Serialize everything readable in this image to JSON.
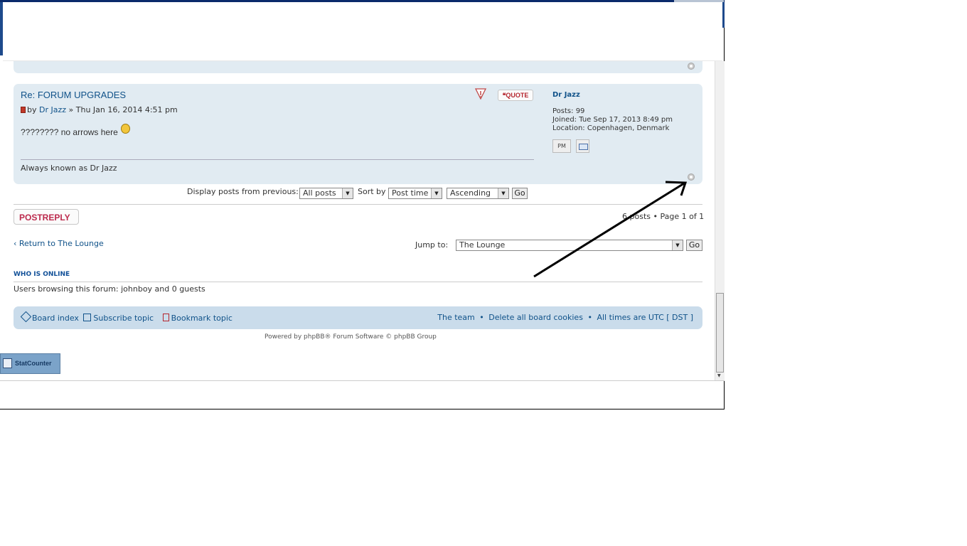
{
  "post": {
    "title": "Re: FORUM UPGRADES",
    "meta_prefix": "by ",
    "author": "Dr Jazz",
    "meta_suffix": " » Thu Jan 16, 2014 4:51 pm",
    "body": "???????? no arrows here",
    "signature": "Always known as Dr Jazz",
    "quote_label": "❝QUOTE",
    "profile": {
      "name": "Dr Jazz",
      "posts_label": "Posts: ",
      "posts_value": "99",
      "joined_label": "Joined: ",
      "joined_value": "Tue Sep 17, 2013 8:49 pm",
      "location_label": "Location: ",
      "location_value": "Copenhagen, Denmark",
      "pm_label": "PM"
    }
  },
  "display": {
    "label": "Display posts from previous:",
    "days_value": "All posts",
    "sort_label": "Sort by",
    "sort_value": "Post time",
    "dir_value": "Ascending",
    "go_label": "Go"
  },
  "actions": {
    "postreply_label": "POSTREPLY",
    "pagination": "6 posts • Page 1 of 1"
  },
  "jump": {
    "return_link": "‹ Return to The Lounge",
    "label": "Jump to:",
    "value": "The Lounge",
    "go_label": "Go"
  },
  "online": {
    "title": "WHO IS ONLINE",
    "text": "Users browsing this forum: johnboy and 0 guests"
  },
  "navbar": {
    "board_index": "Board index",
    "subscribe": "Subscribe topic",
    "bookmark": "Bookmark topic",
    "team": "The team",
    "delete_cookies": "Delete all board cookies",
    "times": "All times are UTC [ DST ]"
  },
  "footer": {
    "powered": "Powered by phpBB® Forum Software © phpBB Group",
    "statcounter": "StatCounter"
  },
  "colors": {
    "panel_bg": "#e1ebf2",
    "navbar_bg": "#cadceb",
    "link": "#105289",
    "accent_red": "#bc2a4d"
  }
}
